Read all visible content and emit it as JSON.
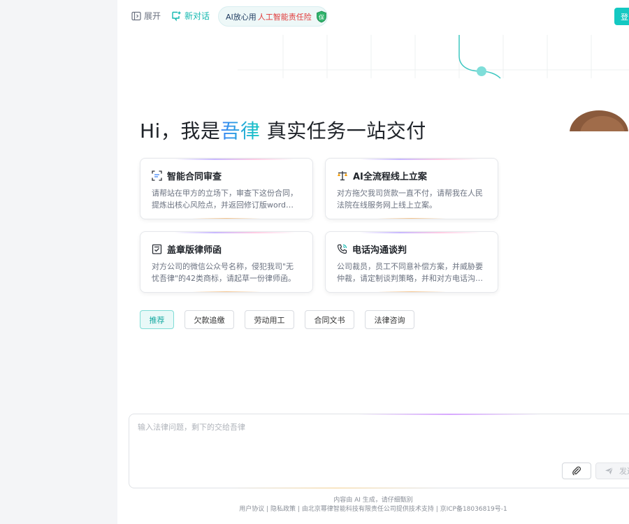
{
  "topbar": {
    "expand_label": "展开",
    "new_chat_label": "新对话",
    "promo_text_1": "AI放心用",
    "promo_text_2": "人工智能责任险",
    "promo_badge": "保",
    "login_label": "登"
  },
  "hero": {
    "greeting": "Hi，我是",
    "brand": "吾律",
    "tagline": " 真实任务一站交付"
  },
  "cards": [
    {
      "title": "智能合同审查",
      "desc": "请帮站在甲方的立场下，审查下这份合同，提炼出核心风险点，并返回修订版word文件",
      "icon": "scan-document-icon"
    },
    {
      "title": "AI全流程线上立案",
      "desc": "对方拖欠我司货款一直不付，请帮我在人民法院在线服务网上线上立案。",
      "icon": "scales-icon"
    },
    {
      "title": "盖章版律师函",
      "desc": "对方公司的微信公众号名称，侵犯我司\"无忧吾律\"的42类商标，请起草一份律师函。",
      "icon": "clipboard-icon"
    },
    {
      "title": "电话沟通谈判",
      "desc": "公司裁员，员工不同意补偿方案，并威胁要仲裁，请定制谈判策略，并和对方电话沟通。",
      "icon": "phone-icon"
    }
  ],
  "tags": [
    "推荐",
    "欠款追缴",
    "劳动用工",
    "合同文书",
    "法律咨询"
  ],
  "active_tag": "推荐",
  "input": {
    "placeholder": "输入法律问题，剩下的交给吾律",
    "value": "",
    "send_label": "发送"
  },
  "footer": {
    "disclaimer": "内容由 AI 生成，请仔细甄别",
    "user_agreement": "用户协议",
    "privacy": "隐私政策",
    "company": "由北京幂律智能科技有限责任公司提供技术支持",
    "icp": "京ICP备18036819号-1"
  },
  "colors": {
    "accent": "#14c8c2",
    "sidebar_bg": "#f4f5f7",
    "promo_red": "#e03a3a"
  }
}
